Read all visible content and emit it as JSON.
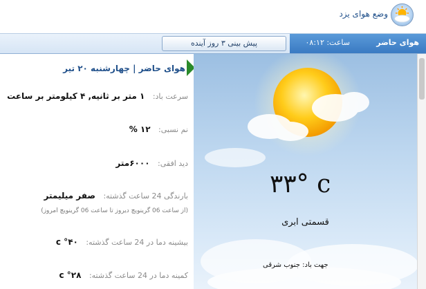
{
  "header": {
    "title": "وضع هوای یزد",
    "icon": "weather-sun-icon"
  },
  "tabs": {
    "current_label": "هوای حاضر",
    "time_label": "ساعت: ۰۸:۱۲",
    "forecast_label": "پیش بینی ۳ روز آینده"
  },
  "details": {
    "title": "هوای حاضر | چهارشنبه ۲۰ تیر",
    "wind_speed_label": "سرعت باد:",
    "wind_speed_value": "۱ متر بر ثانیه, ۴ کیلومتر بر ساعت",
    "humidity_label": "نم نسبی:",
    "humidity_value": "۱۲ %",
    "visibility_label": "دید افقی:",
    "visibility_value": "۶۰۰۰متر",
    "precip_label": "بارندگی 24 ساعت گذشته:",
    "precip_value": "صفر میلیمتر",
    "precip_note": "(از ساعت 06 گرینویچ دیروز تا ساعت 06 گرینویچ امروز)",
    "max_label": "بیشینه دما در 24 ساعت گذشته:",
    "max_value": "۴۰° c",
    "min_label": "کمینه دما در 24 ساعت گذشته:",
    "min_value": "۲۸° c"
  },
  "now": {
    "temperature": "۳۳° c",
    "condition": "قسمتی ابری",
    "wind_direction": "جهت باد: جنوب شرقی",
    "image": "partly-cloudy-sun-icon"
  },
  "colors": {
    "accent": "#3a7ac2",
    "marker": "#2a8a2a"
  }
}
